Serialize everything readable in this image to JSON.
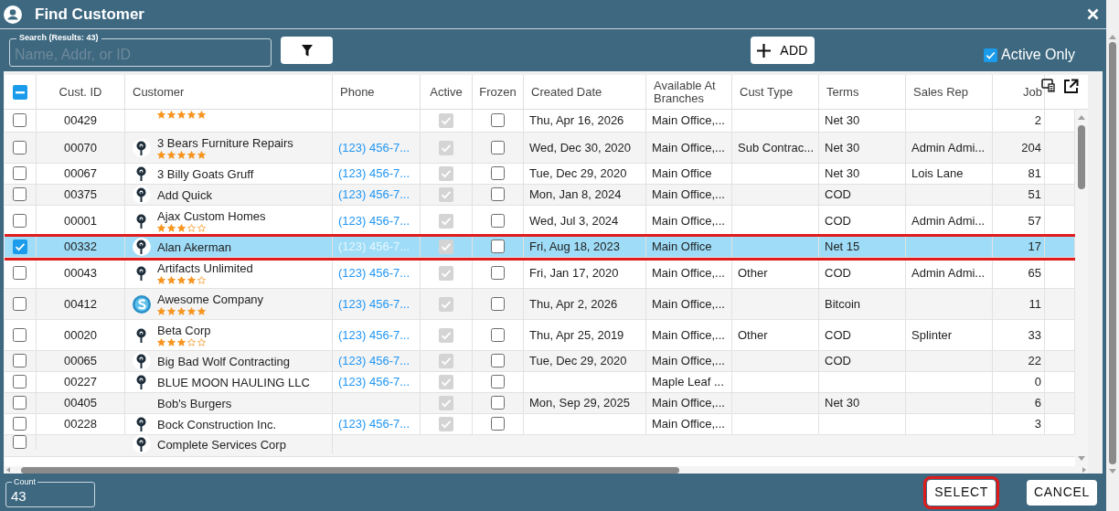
{
  "window": {
    "title": "Find Customer"
  },
  "search": {
    "label": "Search (Results: 43)",
    "placeholder": "Name, Addr, or ID"
  },
  "add_button": "ADD",
  "active_only": {
    "label": "Active Only",
    "checked": true
  },
  "table": {
    "select_all": {
      "indeterminate": true
    },
    "columns": [
      "Cust. ID",
      "Customer",
      "Phone",
      "Active",
      "Frozen",
      "Created Date",
      "Available At Branches",
      "Cust Type",
      "Terms",
      "Sales Rep",
      "Job"
    ],
    "rows": [
      {
        "id": "00429",
        "stars": 5,
        "active": true,
        "frozen": false,
        "created": "Thu, Apr 16, 2026",
        "branches": "Main Office,...",
        "terms": "Net 30",
        "jobs": "2",
        "selected": false
      },
      {
        "id": "00070",
        "logo": {
          "kind": "pin"
        },
        "name": "3 Bears Furniture Repairs",
        "stars": 5,
        "phone": "(123) 456-7...",
        "active": true,
        "frozen": false,
        "created": "Wed, Dec 30, 2020",
        "branches": "Main Office,...",
        "cust_type": "Sub Contrac...",
        "terms": "Net 30",
        "sales_rep": "Admin Admi...",
        "jobs": "204",
        "selected": false
      },
      {
        "id": "00067",
        "logo": {
          "kind": "pin"
        },
        "name": "3 Billy Goats Gruff",
        "phone": "(123) 456-7...",
        "active": true,
        "frozen": false,
        "created": "Tue, Dec 29, 2020",
        "branches": "Main Office",
        "terms": "Net 30",
        "sales_rep": "Lois Lane",
        "jobs": "81",
        "selected": false
      },
      {
        "id": "00375",
        "logo": {
          "kind": "pin"
        },
        "name": "Add Quick",
        "phone": "(123) 456-7...",
        "active": true,
        "frozen": false,
        "created": "Mon, Jan 8, 2024",
        "branches": "Main Office,...",
        "terms": "COD",
        "jobs": "51",
        "selected": false
      },
      {
        "id": "00001",
        "logo": {
          "kind": "pin"
        },
        "name": "Ajax Custom Homes",
        "stars": 3,
        "phone": "(123) 456-7...",
        "active": true,
        "frozen": false,
        "created": "Wed, Jul 3, 2024",
        "branches": "Main Office,...",
        "terms": "COD",
        "sales_rep": "Admin Admi...",
        "jobs": "57",
        "selected": false
      },
      {
        "id": "00332",
        "logo": {
          "kind": "pin"
        },
        "name": "Alan Akerman",
        "phone": "(123) 456-7...",
        "active": true,
        "frozen": false,
        "created": "Fri, Aug 18, 2023",
        "branches": "Main Office",
        "terms": "Net 15",
        "jobs": "17",
        "selected": true
      },
      {
        "id": "00043",
        "logo": {
          "kind": "pin"
        },
        "name": "Artifacts Unlimited",
        "stars": 4,
        "phone": "(123) 456-7...",
        "active": true,
        "frozen": false,
        "created": "Fri, Jan 17, 2020",
        "branches": "Main Office,...",
        "cust_type": "Other",
        "terms": "COD",
        "sales_rep": "Admin Admi...",
        "jobs": "65",
        "selected": false
      },
      {
        "id": "00412",
        "logo": {
          "kind": "swirl"
        },
        "name": "Awesome Company",
        "stars": 5,
        "phone": "(123) 456-7...",
        "active": true,
        "frozen": false,
        "created": "Thu, Apr 2, 2026",
        "branches": "Main Office,...",
        "terms": "Bitcoin",
        "jobs": "11",
        "selected": false
      },
      {
        "id": "00020",
        "logo": {
          "kind": "pin"
        },
        "name": "Beta Corp",
        "stars": 3,
        "phone": "(123) 456-7...",
        "active": true,
        "frozen": false,
        "created": "Thu, Apr 25, 2019",
        "branches": "Main Office,...",
        "cust_type": "Other",
        "terms": "COD",
        "sales_rep": "Splinter",
        "jobs": "33",
        "selected": false
      },
      {
        "id": "00065",
        "logo": {
          "kind": "pin"
        },
        "name": "Big Bad Wolf Contracting",
        "phone": "(123) 456-7...",
        "active": true,
        "frozen": false,
        "created": "Tue, Dec 29, 2020",
        "branches": "Main Office,...",
        "terms": "COD",
        "jobs": "22",
        "selected": false
      },
      {
        "id": "00227",
        "logo": {
          "kind": "pin"
        },
        "name": "BLUE MOON HAULING LLC",
        "phone": "(123) 456-7...",
        "active": true,
        "frozen": false,
        "branches": "Maple Leaf ...",
        "jobs": "0",
        "selected": false
      },
      {
        "id": "00405",
        "name": "Bob's Burgers",
        "active": true,
        "frozen": false,
        "created": "Mon, Sep 29, 2025",
        "branches": "Main Office,...",
        "terms": "Net 30",
        "jobs": "6",
        "selected": false
      },
      {
        "id": "00228",
        "logo": {
          "kind": "pin"
        },
        "name": "Bock Construction Inc.",
        "phone": "(123) 456-7...",
        "active": true,
        "frozen": false,
        "branches": "Main Office,...",
        "jobs": "3",
        "selected": false
      },
      {
        "logo": {
          "kind": "pin"
        },
        "name": "Complete Services Corp",
        "selected": false
      }
    ]
  },
  "count": {
    "label": "Count",
    "value": "43"
  },
  "buttons": [
    {
      "label": "SELECT",
      "highlighted": true
    },
    {
      "label": "CANCEL",
      "highlighted": false
    }
  ]
}
